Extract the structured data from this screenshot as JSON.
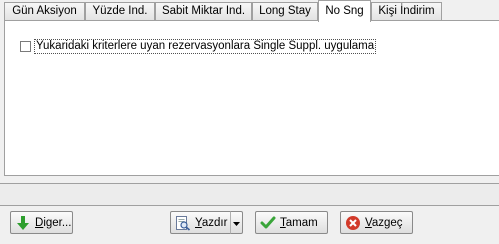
{
  "tabs": [
    {
      "label": "Gün Aksiyon",
      "active": false
    },
    {
      "label": "Yüzde Ind.",
      "active": false
    },
    {
      "label": "Sabit Miktar Ind.",
      "active": false
    },
    {
      "label": "Long Stay",
      "active": false
    },
    {
      "label": "No Sng",
      "active": true
    },
    {
      "label": "Kişi İndirim",
      "active": false
    }
  ],
  "panel": {
    "option_label": "Yukaridaki kriterlere uyan rezervasyonlara Single Suppl. uygulama",
    "option_checked": false
  },
  "buttons": {
    "other": {
      "label": "Diger...",
      "mnemonic": "D",
      "rest": "iger..."
    },
    "print": {
      "label": "Yazdır",
      "mnemonic": "Y",
      "rest": "azdır"
    },
    "ok": {
      "label": "Tamam",
      "mnemonic": "T",
      "rest": "amam"
    },
    "cancel": {
      "label": "Vazgeç",
      "mnemonic": "V",
      "rest": "azgeç"
    }
  },
  "icons": {
    "other": "arrow-down-icon",
    "print": "print-preview-icon",
    "print_menu": "chevron-down-icon",
    "ok": "checkmark-icon",
    "cancel": "cancel-icon"
  },
  "colors": {
    "arrow_green": "#2e9e2e",
    "check_green": "#3aa53a",
    "cancel_red": "#d23a2a"
  }
}
